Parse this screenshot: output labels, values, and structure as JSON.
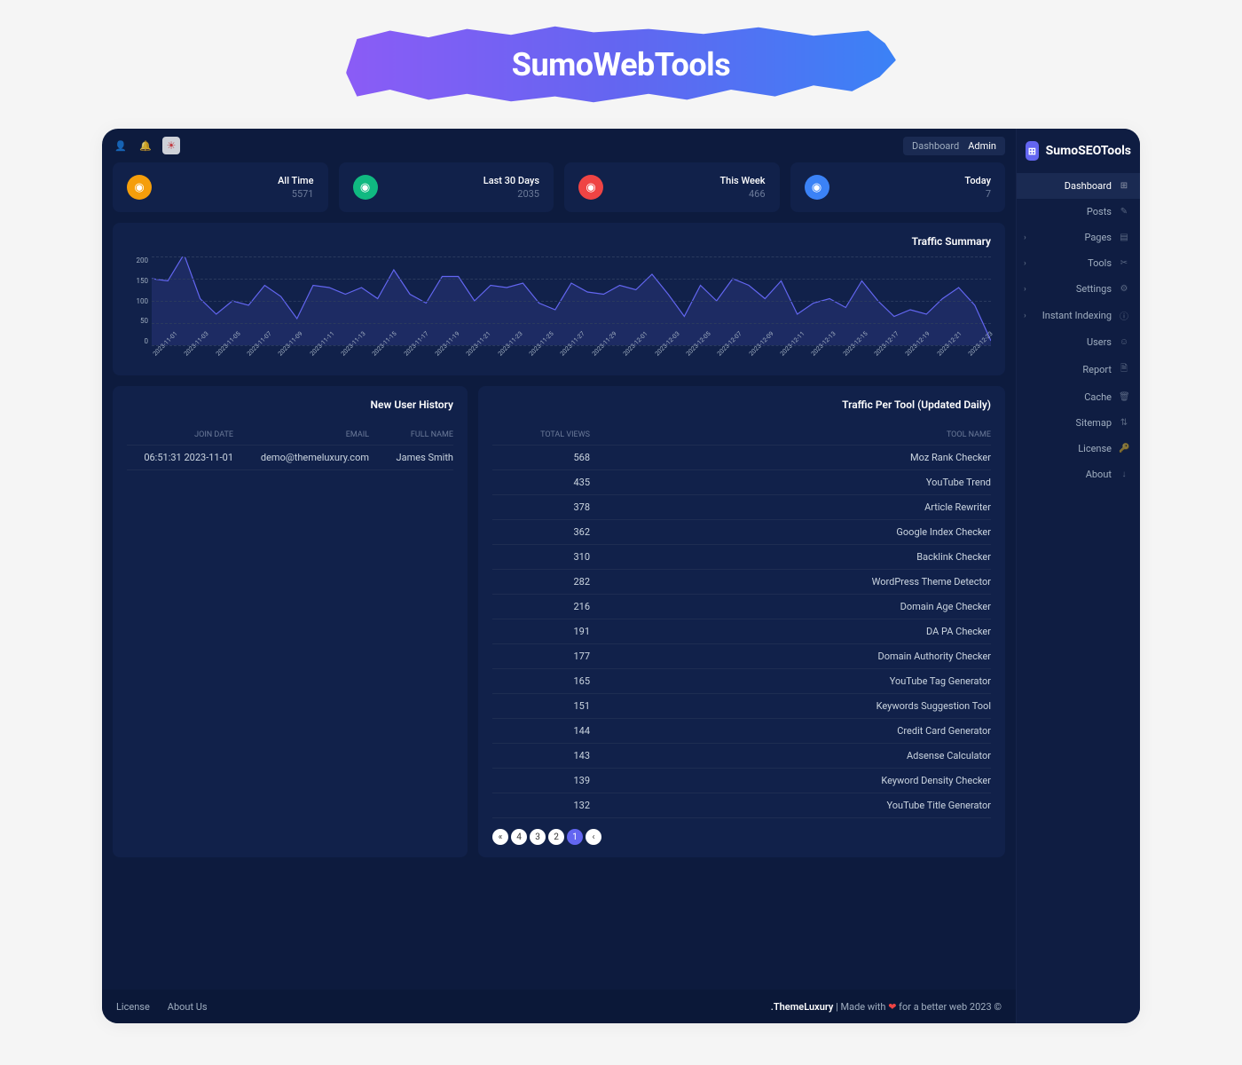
{
  "hero": {
    "title": "SumoWebTools"
  },
  "brand": {
    "name": "SumoSEOTools"
  },
  "breadcrumb": {
    "root": "Dashboard",
    "current": "Admin"
  },
  "sidebar": {
    "items": [
      {
        "label": "Dashboard",
        "icon": "⊞",
        "active": true
      },
      {
        "label": "Posts",
        "icon": "✎"
      },
      {
        "label": "Pages",
        "icon": "▤",
        "chevron": true
      },
      {
        "label": "Tools",
        "icon": "✂",
        "chevron": true
      },
      {
        "label": "Settings",
        "icon": "⚙",
        "chevron": true
      },
      {
        "label": "Instant Indexing",
        "icon": "ⓘ",
        "chevron": true
      },
      {
        "label": "Users",
        "icon": "☺"
      },
      {
        "label": "Report",
        "icon": "🗎"
      },
      {
        "label": "Cache",
        "icon": "🗑"
      },
      {
        "label": "Sitemap",
        "icon": "⇅"
      },
      {
        "label": "License",
        "icon": "🔑"
      },
      {
        "label": "About",
        "icon": "↓"
      }
    ]
  },
  "stats": [
    {
      "label": "All Time",
      "value": "5571",
      "color": "#f59e0b"
    },
    {
      "label": "Last 30 Days",
      "value": "2035",
      "color": "#10b981"
    },
    {
      "label": "This Week",
      "value": "466",
      "color": "#ef4444"
    },
    {
      "label": "Today",
      "value": "7",
      "color": "#3b82f6"
    }
  ],
  "chart_title": "Traffic Summary",
  "chart_data": {
    "type": "line",
    "ylabel": "",
    "ylim": [
      0,
      200
    ],
    "yticks": [
      0,
      50,
      100,
      150,
      200
    ],
    "categories": [
      "2023-11-01",
      "2023-11-03",
      "2023-11-05",
      "2023-11-07",
      "2023-11-09",
      "2023-11-11",
      "2023-11-13",
      "2023-11-15",
      "2023-11-17",
      "2023-11-19",
      "2023-11-21",
      "2023-11-23",
      "2023-11-25",
      "2023-11-27",
      "2023-11-29",
      "2023-12-01",
      "2023-12-03",
      "2023-12-05",
      "2023-12-07",
      "2023-12-09",
      "2023-12-11",
      "2023-12-13",
      "2023-12-15",
      "2023-12-17",
      "2023-12-19",
      "2023-12-21",
      "2023-12-23"
    ],
    "values": [
      150,
      145,
      205,
      105,
      70,
      100,
      90,
      135,
      110,
      60,
      135,
      130,
      115,
      130,
      105,
      170,
      115,
      95,
      155,
      155,
      100,
      135,
      130,
      140,
      95,
      80,
      140,
      120,
      115,
      135,
      125,
      160,
      115,
      65,
      135,
      100,
      150,
      135,
      105,
      145,
      70,
      95,
      105,
      85,
      145,
      100,
      65,
      80,
      70,
      105,
      130,
      90,
      10
    ]
  },
  "user_history": {
    "title": "New User History",
    "headers": {
      "join": "JOIN DATE",
      "email": "EMAIL",
      "name": "FULL NAME"
    },
    "rows": [
      {
        "join": "06:51:31 2023-11-01",
        "email": "demo@themeluxury.com",
        "name": "James Smith"
      }
    ]
  },
  "tool_traffic": {
    "title": "Traffic Per Tool (Updated Daily)",
    "headers": {
      "views": "TOTAL VIEWS",
      "name": "TOOL NAME"
    },
    "rows": [
      {
        "views": "568",
        "name": "Moz Rank Checker"
      },
      {
        "views": "435",
        "name": "YouTube Trend"
      },
      {
        "views": "378",
        "name": "Article Rewriter"
      },
      {
        "views": "362",
        "name": "Google Index Checker"
      },
      {
        "views": "310",
        "name": "Backlink Checker"
      },
      {
        "views": "282",
        "name": "WordPress Theme Detector"
      },
      {
        "views": "216",
        "name": "Domain Age Checker"
      },
      {
        "views": "191",
        "name": "DA PA Checker"
      },
      {
        "views": "177",
        "name": "Domain Authority Checker"
      },
      {
        "views": "165",
        "name": "YouTube Tag Generator"
      },
      {
        "views": "151",
        "name": "Keywords Suggestion Tool"
      },
      {
        "views": "144",
        "name": "Credit Card Generator"
      },
      {
        "views": "143",
        "name": "Adsense Calculator"
      },
      {
        "views": "139",
        "name": "Keyword Density Checker"
      },
      {
        "views": "132",
        "name": "YouTube Title Generator"
      }
    ],
    "pagination": [
      "«",
      "4",
      "3",
      "2",
      "1",
      "‹"
    ]
  },
  "footer": {
    "license": "License",
    "about": "About Us",
    "brand_suffix": ".ThemeLuxury",
    "made_pre": " | Made with ",
    "made_post": " for a better web 2023 ©"
  }
}
